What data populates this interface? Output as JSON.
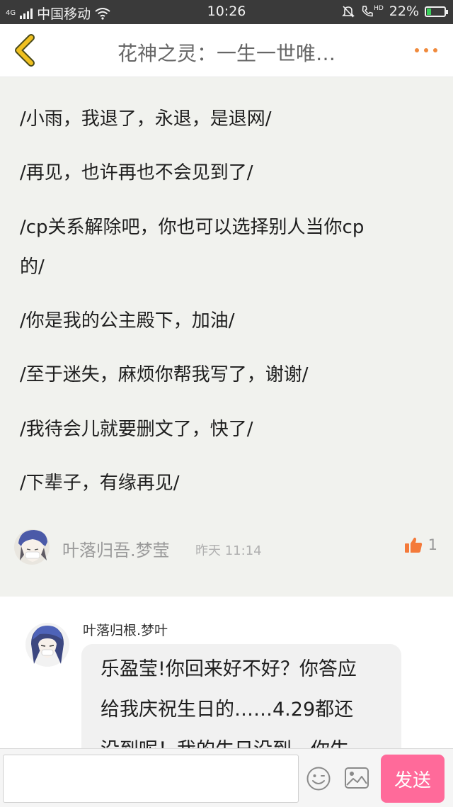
{
  "status_bar": {
    "network_type": "4G",
    "carrier": "中国移动",
    "time": "10:26",
    "hd_label": "HD",
    "battery": "22%",
    "battery_fraction": 0.22,
    "icons": [
      "signal-icon",
      "wifi-icon",
      "mute-bell-icon",
      "call-hd-icon",
      "battery-charging-icon"
    ]
  },
  "header": {
    "title": "花神之灵：一生一世唯…",
    "back_icon": "chevron-left-icon",
    "more_icon": "more-dots-icon",
    "accent_color": "#f0c020"
  },
  "post": {
    "lines": [
      "/小雨，我退了，永退，是退网/",
      "/再见，也许再也不会见到了/",
      "/cp关系解除吧，你也可以选择别人当你cp",
      "的/",
      "/你是我的公主殿下，加油/",
      "/至于迷失，麻烦你帮我写了，谢谢/",
      "/我待会儿就要删文了，快了/",
      "/下辈子，有缘再见/"
    ],
    "author": "叶落归吾.梦莹",
    "time": "昨天 11:14",
    "likes": "1",
    "like_icon": "thumbs-up-icon",
    "like_color": "#f47a3a"
  },
  "reply": {
    "author": "叶落归根.梦叶",
    "lines": [
      "乐盈莹!你回来好不好？你答应",
      "给我庆祝生日的……4.29都还",
      "没到呢！我的生日没到，你生"
    ]
  },
  "composer": {
    "placeholder": "",
    "emoji_icon": "emoji-icon",
    "image_icon": "image-icon",
    "send_label": "发送",
    "send_color": "#ff6a9a"
  }
}
